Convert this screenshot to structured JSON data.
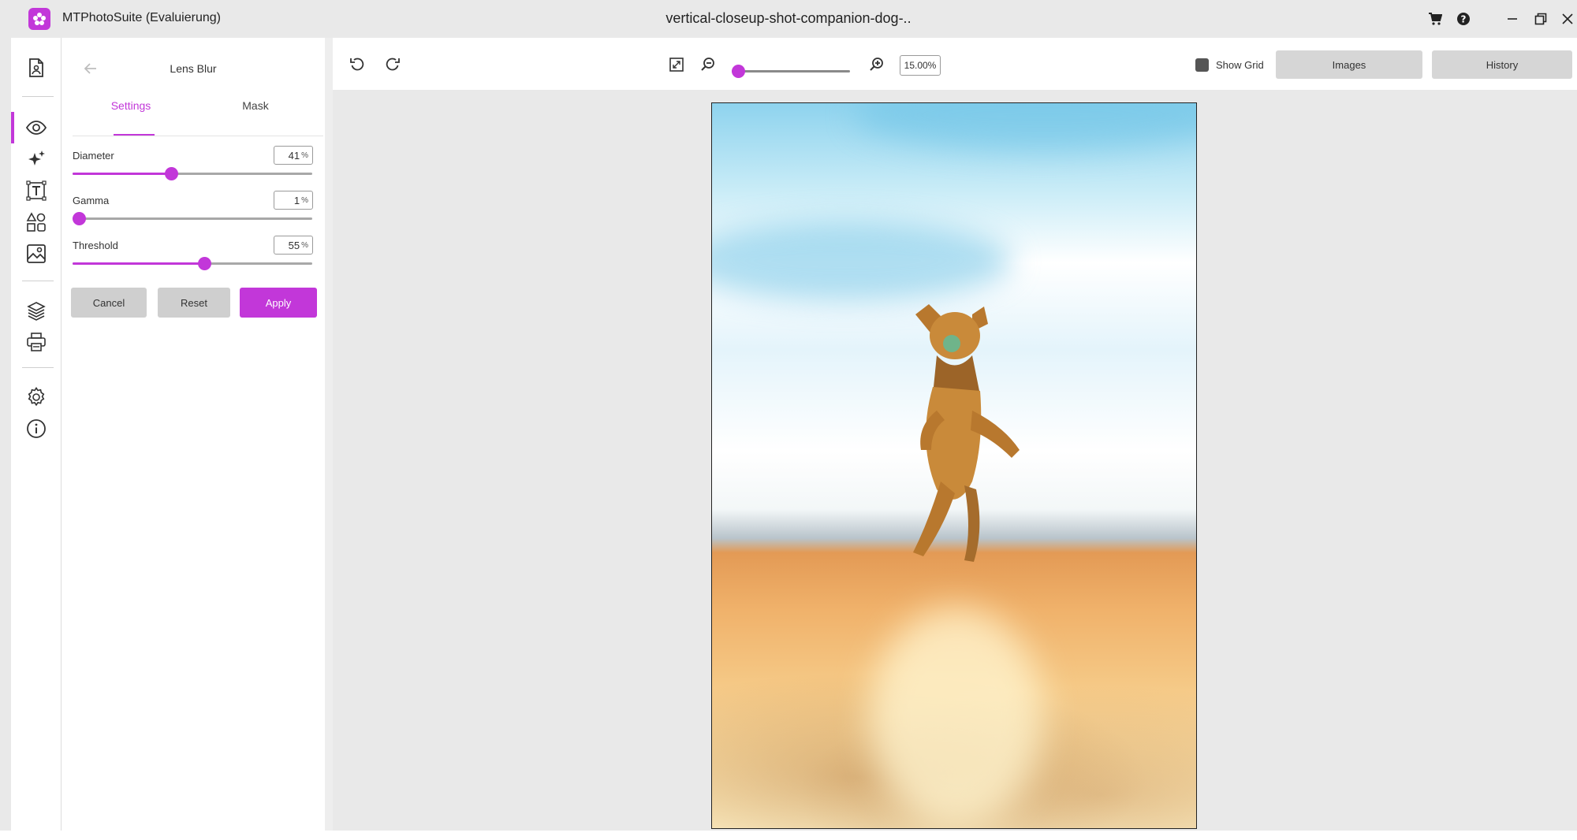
{
  "window": {
    "app_title": "MTPhotoSuite (Evaluierung)",
    "file_title": "vertical-closeup-shot-companion-dog-.."
  },
  "panel": {
    "title": "Lens Blur",
    "tabs": [
      {
        "label": "Settings",
        "active": true
      },
      {
        "label": "Mask",
        "active": false
      }
    ],
    "params": [
      {
        "label": "Diameter",
        "value": "41",
        "unit": "%",
        "fraction": 0.41
      },
      {
        "label": "Gamma",
        "value": "1",
        "unit": "%",
        "fraction": 0.01
      },
      {
        "label": "Threshold",
        "value": "55",
        "unit": "%",
        "fraction": 0.55
      }
    ],
    "buttons": {
      "cancel": "Cancel",
      "reset": "Reset",
      "apply": "Apply"
    }
  },
  "toolbar": {
    "zoom_value": "15.00%",
    "zoom_fraction": 0.0,
    "show_grid_label": "Show Grid",
    "show_grid_checked": true,
    "images_label": "Images",
    "history_label": "History"
  },
  "colors": {
    "accent": "#c237d9",
    "chrome": "#e9e9e9",
    "button_gray": "#cfcfcf"
  },
  "icons": {
    "titlebar": [
      "cart-icon",
      "help-icon",
      "minimize-icon",
      "restore-icon",
      "close-icon"
    ],
    "rail": [
      "document-icon",
      "eye-icon",
      "sparkle-icon",
      "text-icon",
      "shapes-icon",
      "image-icon",
      "layers-icon",
      "printer-icon",
      "gear-icon",
      "info-icon"
    ],
    "toolbar": [
      "undo-icon",
      "redo-icon",
      "fit-screen-icon",
      "zoom-out-icon",
      "zoom-in-icon"
    ]
  }
}
